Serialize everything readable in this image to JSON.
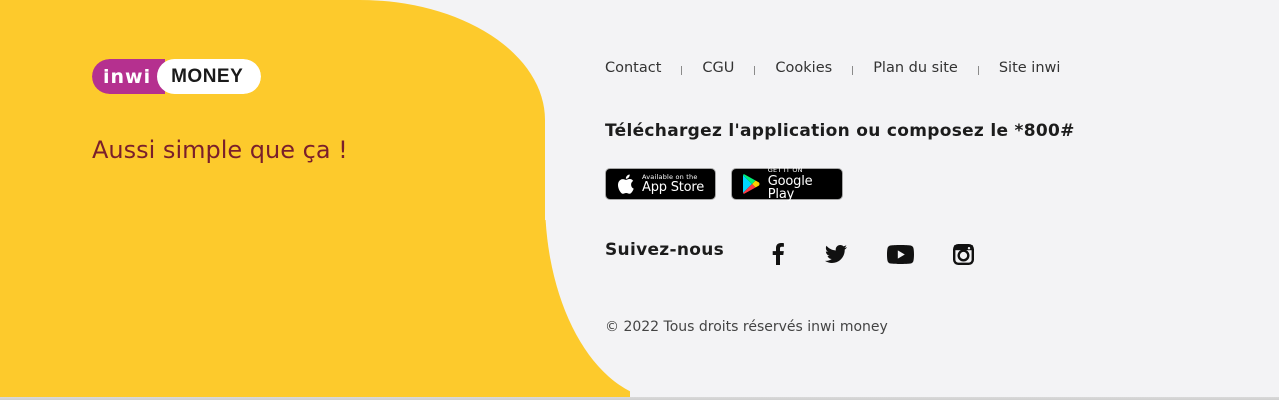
{
  "brand": {
    "logo_inwi": "inwi",
    "logo_money": "MONEY",
    "tagline": "Aussi simple que ça !",
    "colors": {
      "yellow": "#fdca2c",
      "magenta": "#b5308f",
      "tagline": "#7a1f2b",
      "background": "#f3f3f5"
    }
  },
  "nav": {
    "items": [
      {
        "label": "Contact"
      },
      {
        "label": "CGU"
      },
      {
        "label": "Cookies"
      },
      {
        "label": "Plan du site"
      },
      {
        "label": "Site inwi"
      }
    ]
  },
  "download": {
    "title": "Téléchargez l'application ou composez le *800#",
    "app_store": {
      "small": "Available on the",
      "big": "App Store",
      "icon": "apple-icon"
    },
    "google_play": {
      "small": "GET IT ON",
      "big": "Google Play",
      "icon": "google-play-icon"
    }
  },
  "social": {
    "title": "Suivez-nous",
    "icons": [
      "facebook-icon",
      "twitter-icon",
      "youtube-icon",
      "instagram-icon"
    ]
  },
  "footer": {
    "copyright": "© 2022 Tous droits réservés inwi money"
  }
}
